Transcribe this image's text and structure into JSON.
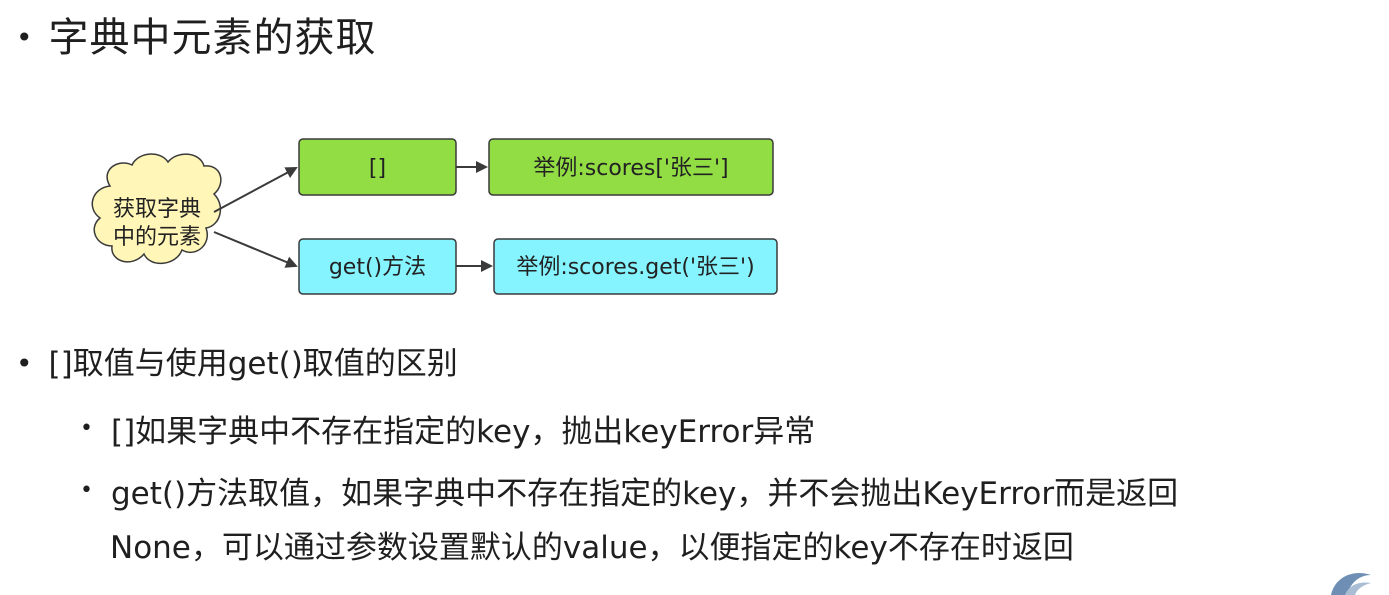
{
  "heading1": "字典中元素的获取",
  "diagram": {
    "cloud_lines": [
      "获取字典",
      "中的元素"
    ],
    "box_bracket": "[]",
    "box_bracket_example": "举例:scores['张三']",
    "box_get": "get()方法",
    "box_get_example": "举例:scores.get('张三')",
    "colors": {
      "green": "#92dc44",
      "cyan": "#85f4ff",
      "cloud": "#fff6b8",
      "stroke": "#3a3a3a"
    }
  },
  "heading2": "[]取值与使用get()取值的区别",
  "points": [
    "[]如果字典中不存在指定的key，抛出keyError异常",
    "get()方法取值，如果字典中不存在指定的key，并不会抛出KeyError而是返回",
    "None，可以通过参数设置默认的value，以便指定的key不存在时返回"
  ]
}
